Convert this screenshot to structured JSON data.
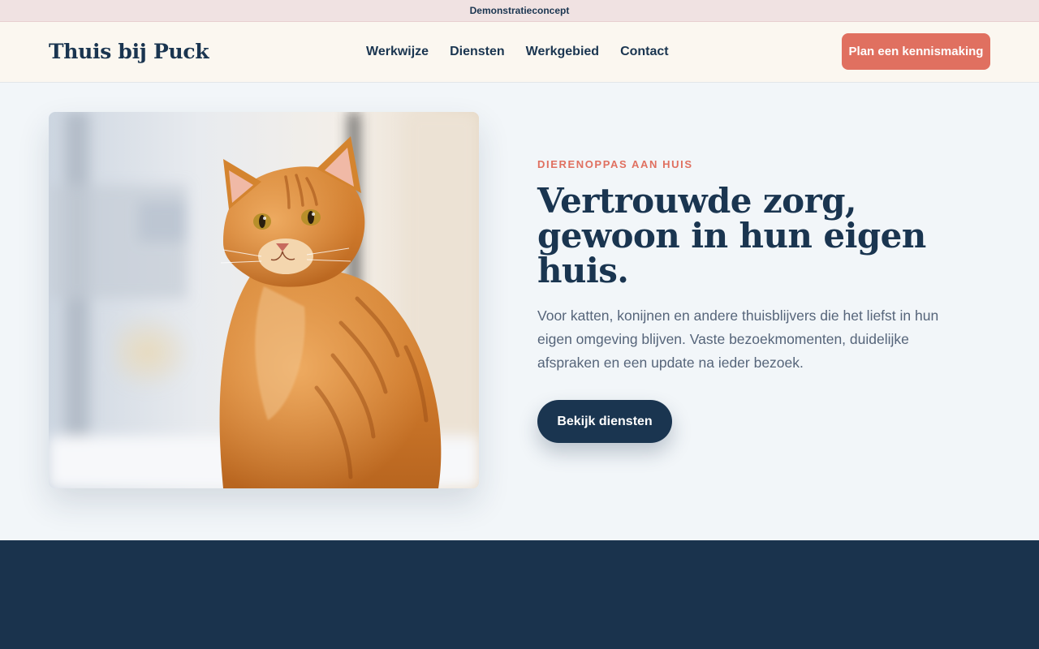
{
  "banner": {
    "text": "Demonstratieconcept"
  },
  "header": {
    "brand": "Thuis bij Puck",
    "nav": [
      "Werkwijze",
      "Diensten",
      "Werkgebied",
      "Contact"
    ],
    "cta": "Plan een kennismaking"
  },
  "hero": {
    "image_subject": "cat-photo",
    "eyebrow": "DIERENOPPAS AAN HUIS",
    "headline": "Vertrouwde zorg, gewoon in hun eigen huis.",
    "lead": "Voor katten, konijnen en andere thuisblijvers die het liefst in hun eigen omgeving blijven. Vaste bezoekmomenten, duidelijke afspraken en een update na ieder bezoek.",
    "cta": "Bekijk diensten"
  },
  "colors": {
    "navy": "#1a3550",
    "coral": "#e07060",
    "cream": "#fbf7f0",
    "banner": "#f0e2e2",
    "hero_bg": "#f2f6f9",
    "band": "#1a334d"
  }
}
